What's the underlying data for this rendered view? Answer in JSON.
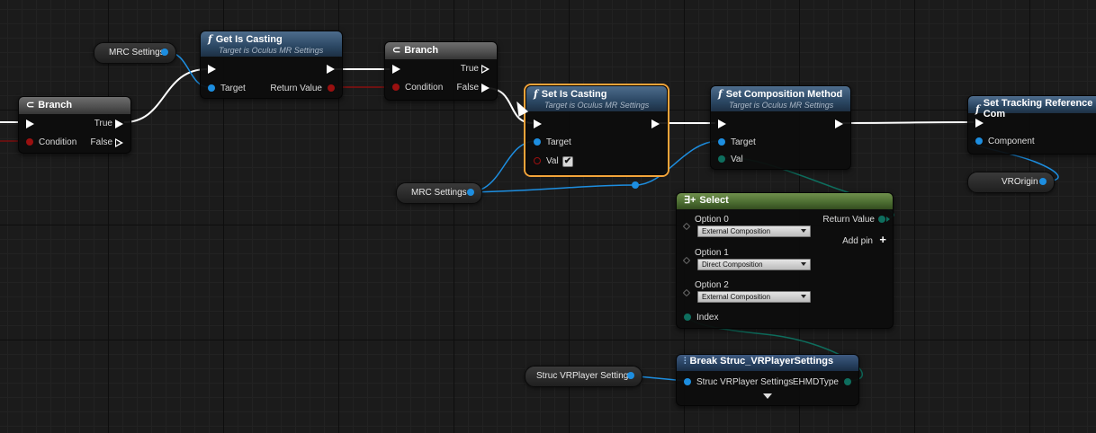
{
  "colors": {
    "exec": "#ffffff",
    "object_pin": "#1d8ee0",
    "bool_pin": "#9a1010",
    "enum_pin": "#0e6e5e",
    "function_header": "#2b4763",
    "branch_header": "#4e4e4e",
    "select_header": "#4a6b30"
  },
  "nodes": {
    "branch1": {
      "title": "Branch",
      "pins": {
        "true": "True",
        "condition": "Condition",
        "false": "False"
      }
    },
    "getIsCasting": {
      "title": "Get Is Casting",
      "subtitle": "Target is Oculus MR Settings",
      "pins": {
        "target": "Target",
        "return": "Return Value"
      }
    },
    "branch2": {
      "title": "Branch",
      "pins": {
        "true": "True",
        "condition": "Condition",
        "false": "False"
      }
    },
    "setIsCasting": {
      "title": "Set Is Casting",
      "subtitle": "Target is Oculus MR Settings",
      "pins": {
        "target": "Target",
        "val": "Val"
      },
      "val_checked": "✔"
    },
    "setComposition": {
      "title": "Set Composition Method",
      "subtitle": "Target is Oculus MR Settings",
      "pins": {
        "target": "Target",
        "val": "Val"
      }
    },
    "setTracking": {
      "title": "Set Tracking Reference Com",
      "pins": {
        "component": "Component"
      }
    },
    "select": {
      "title": "Select",
      "return_value": "Return Value",
      "add_pin": "Add pin",
      "options": [
        {
          "label": "Option 0",
          "value": "External Composition"
        },
        {
          "label": "Option 1",
          "value": "Direct Composition"
        },
        {
          "label": "Option 2",
          "value": "External Composition"
        }
      ],
      "index": "Index"
    },
    "breakStruct": {
      "title": "Break Struc_VRPlayerSettings",
      "pins": {
        "input": "Struc VRPlayer Settings",
        "output": "EHMDType"
      }
    }
  },
  "getters": {
    "mrc1": "MRC Settings",
    "mrc2": "MRC Settings",
    "vrorigin": "VROrigin",
    "struc": "Struc VRPlayer Settings"
  },
  "icons": {
    "function": "f",
    "branch": "branch-icon",
    "select": "select-icon",
    "break": "break-struct-icon",
    "expand": "expand-arrow-icon"
  }
}
